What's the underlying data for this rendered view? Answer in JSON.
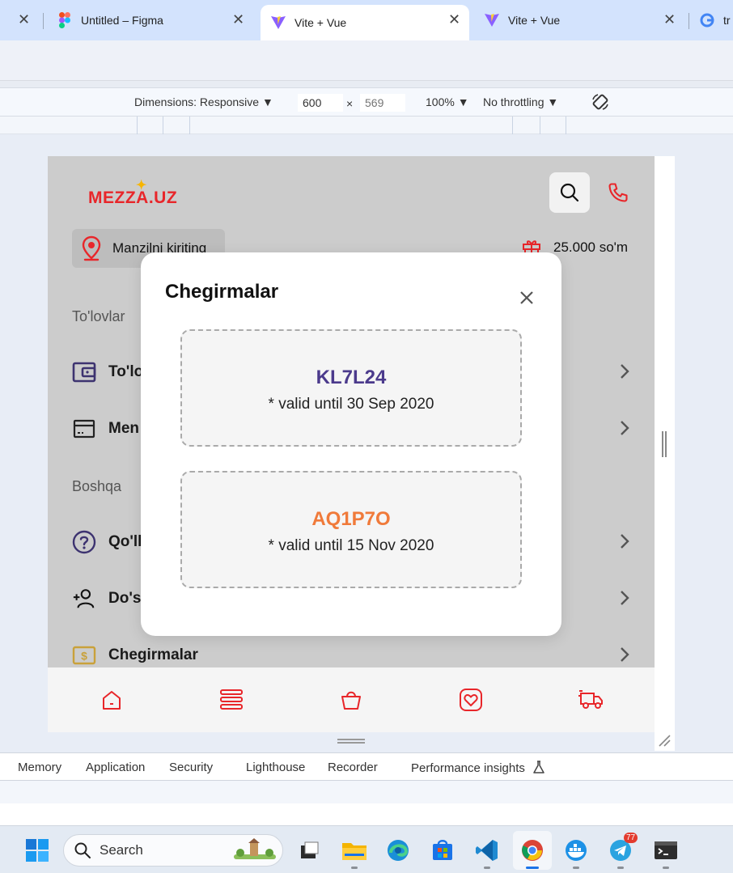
{
  "browser": {
    "tabs": [
      {
        "title": "",
        "active": false
      },
      {
        "title": "Untitled – Figma",
        "active": false
      },
      {
        "title": "Vite + Vue",
        "active": true
      },
      {
        "title": "Vite + Vue",
        "active": false
      },
      {
        "title": "tr",
        "active": false
      }
    ]
  },
  "device_toolbar": {
    "dimensions_label": "Dimensions: Responsive",
    "width_value": "600",
    "height_placeholder": "569",
    "times": "×",
    "zoom": "100%",
    "throttling": "No throttling"
  },
  "app": {
    "logo_text": "MEZZA.UZ",
    "address_placeholder": "Manzilni kiriting",
    "balance": "25.000 so'm",
    "sections": [
      {
        "label": "To'lovlar"
      },
      {
        "label": "Boshqa"
      }
    ],
    "menu": [
      {
        "label": "To'lo",
        "icon": "wallet-icon"
      },
      {
        "label": "Men",
        "icon": "card-icon"
      },
      {
        "label": "Qo'll",
        "icon": "help-icon"
      },
      {
        "label": "Do'st",
        "icon": "add-user-icon"
      },
      {
        "label": "Chegirmalar",
        "icon": "discount-icon"
      }
    ],
    "bottom_nav": [
      "home-icon",
      "menu-icon",
      "basket-icon",
      "favorites-icon",
      "delivery-icon"
    ]
  },
  "modal": {
    "title": "Chegirmalar",
    "coupons": [
      {
        "code": "KL7L24",
        "valid": "* valid until 30 Sep 2020",
        "color": "#4b3a8c"
      },
      {
        "code": "AQ1P7O",
        "valid": "* valid until 15 Nov 2020",
        "color": "#f07a3a"
      }
    ]
  },
  "devtools_tabs": [
    "Memory",
    "Application",
    "Security",
    "Lighthouse",
    "Recorder",
    "Performance insights"
  ],
  "taskbar": {
    "search_label": "Search",
    "telegram_badge": "77"
  },
  "colors": {
    "brand_red": "#e8262a",
    "overlay_gray": "#cccccc",
    "purple": "#4b3a8c",
    "orange": "#f07a3a"
  }
}
